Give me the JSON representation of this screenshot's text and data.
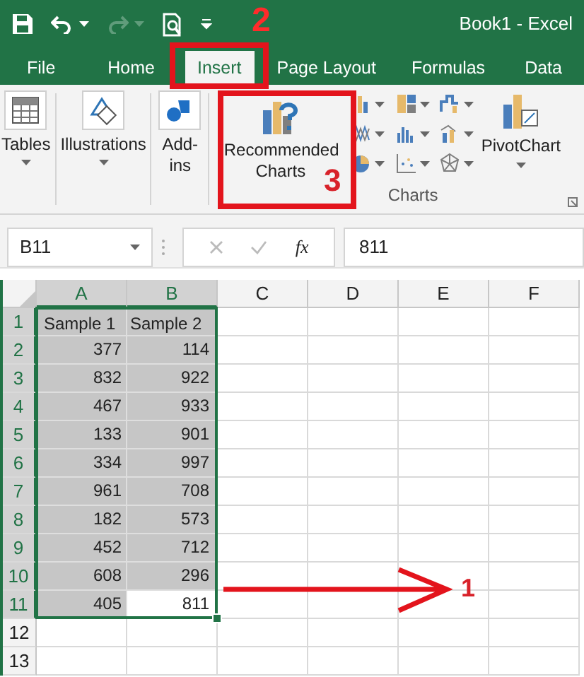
{
  "title_bar": {
    "title": "Book1 - Excel"
  },
  "tabs": [
    {
      "label": "File",
      "selected": false
    },
    {
      "label": "Home",
      "selected": false
    },
    {
      "label": "Insert",
      "selected": true
    },
    {
      "label": "Page Layout",
      "selected": false
    },
    {
      "label": "Formulas",
      "selected": false
    },
    {
      "label": "Data",
      "selected": false
    }
  ],
  "ribbon": {
    "buttons": [
      {
        "kind": "tables",
        "label": "Tables"
      },
      {
        "kind": "illustrations",
        "label": "Illustrations"
      },
      {
        "kind": "addins",
        "label": "Add-ins"
      }
    ],
    "recommended_charts": "Recommended Charts",
    "charts_group": "Charts",
    "pivot_chart": "PivotChart"
  },
  "formula_bar": {
    "name_box": "B11",
    "function_label": "fx",
    "value": "811"
  },
  "grid": {
    "columns": [
      {
        "label": "A",
        "selected": true
      },
      {
        "label": "B",
        "selected": true
      },
      {
        "label": "C",
        "selected": false
      },
      {
        "label": "D",
        "selected": false
      },
      {
        "label": "E",
        "selected": false
      },
      {
        "label": "F",
        "selected": false
      }
    ],
    "rows": [
      {
        "header": "1",
        "selected": true,
        "cells": [
          {
            "kind": "text",
            "text": "Sample 1",
            "selected": true
          },
          {
            "kind": "text",
            "text": "Sample 2",
            "selected": true
          }
        ]
      },
      {
        "header": "2",
        "selected": true,
        "cells": [
          {
            "kind": "number",
            "text": "377",
            "selected": true
          },
          {
            "kind": "number",
            "text": "114",
            "selected": true
          }
        ]
      },
      {
        "header": "3",
        "selected": true,
        "cells": [
          {
            "kind": "number",
            "text": "832",
            "selected": true
          },
          {
            "kind": "number",
            "text": "922",
            "selected": true
          }
        ]
      },
      {
        "header": "4",
        "selected": true,
        "cells": [
          {
            "kind": "number",
            "text": "467",
            "selected": true
          },
          {
            "kind": "number",
            "text": "933",
            "selected": true
          }
        ]
      },
      {
        "header": "5",
        "selected": true,
        "cells": [
          {
            "kind": "number",
            "text": "133",
            "selected": true
          },
          {
            "kind": "number",
            "text": "901",
            "selected": true
          }
        ]
      },
      {
        "header": "6",
        "selected": true,
        "cells": [
          {
            "kind": "number",
            "text": "334",
            "selected": true
          },
          {
            "kind": "number",
            "text": "997",
            "selected": true
          }
        ]
      },
      {
        "header": "7",
        "selected": true,
        "cells": [
          {
            "kind": "number",
            "text": "961",
            "selected": true
          },
          {
            "kind": "number",
            "text": "708",
            "selected": true
          }
        ]
      },
      {
        "header": "8",
        "selected": true,
        "cells": [
          {
            "kind": "number",
            "text": "182",
            "selected": true
          },
          {
            "kind": "number",
            "text": "573",
            "selected": true
          }
        ]
      },
      {
        "header": "9",
        "selected": true,
        "cells": [
          {
            "kind": "number",
            "text": "452",
            "selected": true
          },
          {
            "kind": "number",
            "text": "712",
            "selected": true
          }
        ]
      },
      {
        "header": "10",
        "selected": true,
        "cells": [
          {
            "kind": "number",
            "text": "608",
            "selected": true
          },
          {
            "kind": "number",
            "text": "296",
            "selected": true
          }
        ]
      },
      {
        "header": "11",
        "selected": true,
        "cells": [
          {
            "kind": "number",
            "text": "405",
            "selected": true
          },
          {
            "kind": "number",
            "text": "811",
            "selected": false
          }
        ]
      },
      {
        "header": "12",
        "selected": false
      },
      {
        "header": "13",
        "selected": false
      }
    ]
  },
  "annotations": [
    {
      "label": "2"
    },
    {
      "label": "3"
    },
    {
      "label": "1"
    }
  ]
}
